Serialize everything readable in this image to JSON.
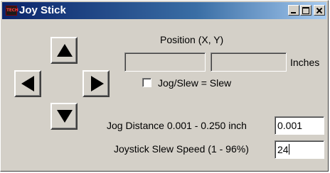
{
  "window": {
    "title": "Joy Stick",
    "app_icon_text": "TECH",
    "controls": [
      "minimize",
      "maximize",
      "close"
    ]
  },
  "joystick": {
    "buttons": [
      "up",
      "left",
      "right",
      "down"
    ]
  },
  "position": {
    "label": "Position (X, Y)",
    "x_value": "",
    "y_value": "",
    "unit": "Inches"
  },
  "jog_slew": {
    "label": "Jog/Slew = Slew",
    "checked": false
  },
  "jog_distance": {
    "label": "Jog Distance 0.001 - 0.250 inch",
    "value": "0.001"
  },
  "slew_speed": {
    "label": "Joystick Slew Speed (1 - 96%)",
    "value": "24"
  }
}
